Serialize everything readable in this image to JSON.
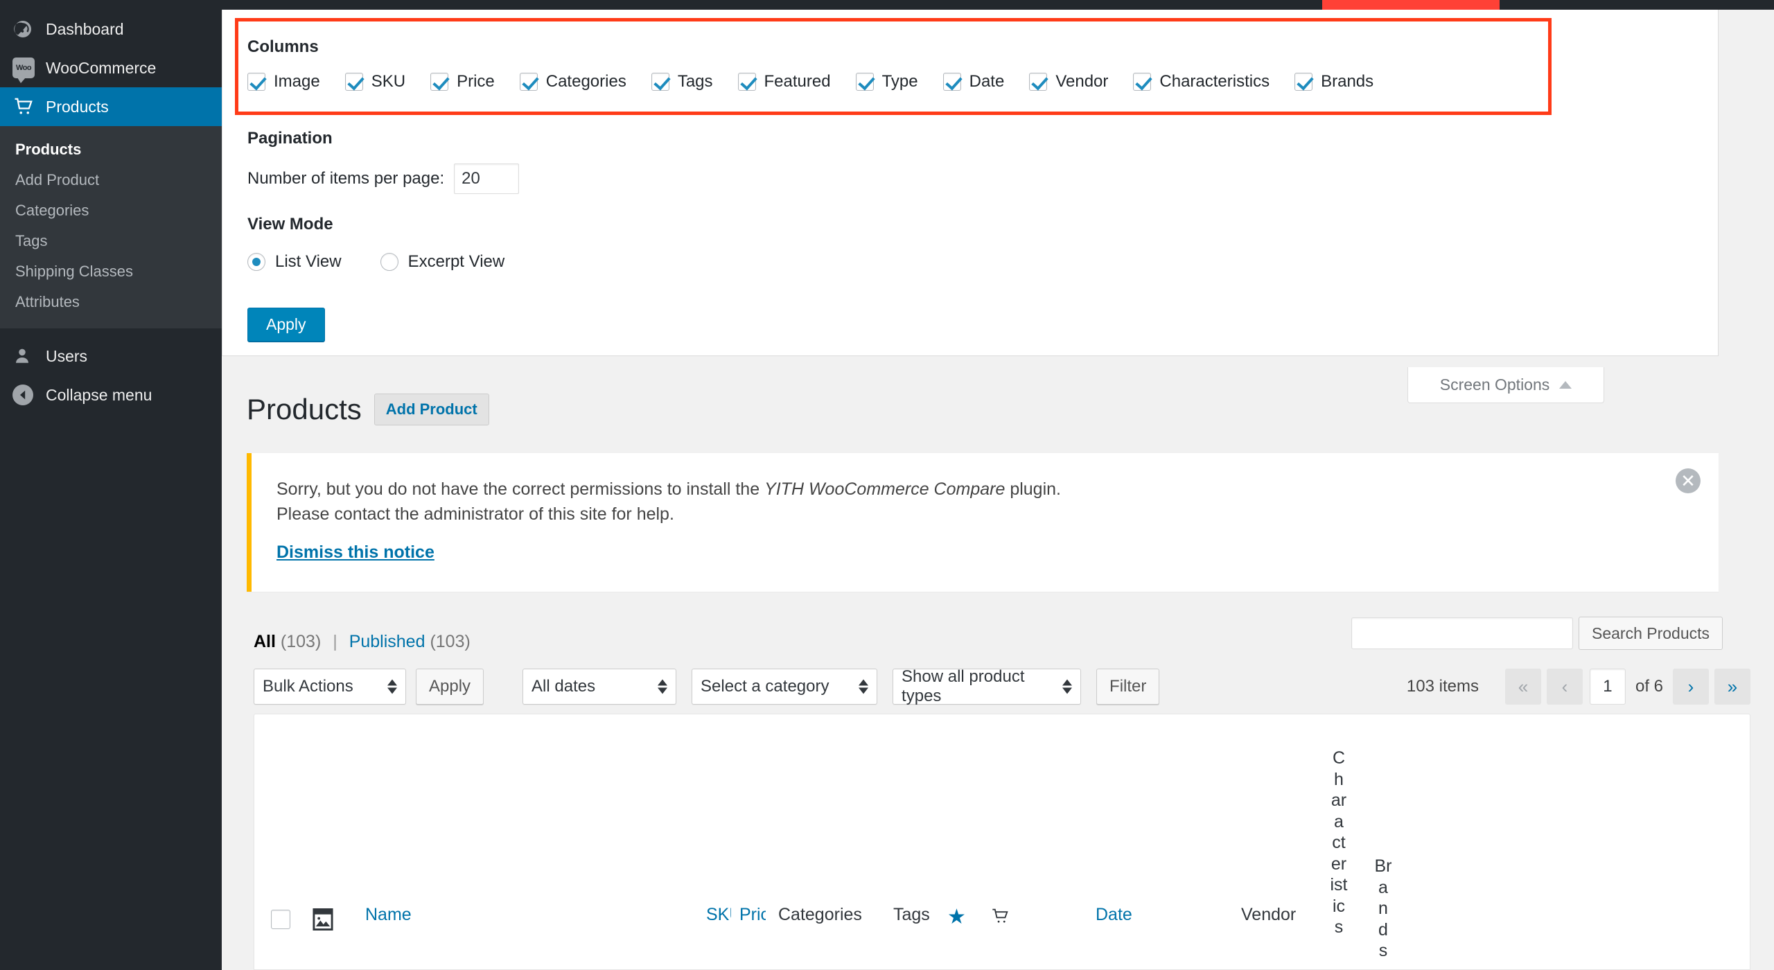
{
  "sidebar": {
    "items": [
      {
        "label": "Dashboard",
        "icon": "dashboard-icon",
        "current": false
      },
      {
        "label": "WooCommerce",
        "icon": "woo-icon",
        "current": false
      },
      {
        "label": "Products",
        "icon": "cart-icon",
        "current": true
      }
    ],
    "submenu": [
      {
        "label": "Products",
        "active": true
      },
      {
        "label": "Add Product",
        "active": false
      },
      {
        "label": "Categories",
        "active": false
      },
      {
        "label": "Tags",
        "active": false
      },
      {
        "label": "Shipping Classes",
        "active": false
      },
      {
        "label": "Attributes",
        "active": false
      }
    ],
    "bottom": [
      {
        "label": "Users",
        "icon": "user-icon"
      },
      {
        "label": "Collapse menu",
        "icon": "collapse-arrow-icon"
      }
    ]
  },
  "screen_options": {
    "columns_title": "Columns",
    "columns": [
      {
        "label": "Image",
        "checked": true
      },
      {
        "label": "SKU",
        "checked": true
      },
      {
        "label": "Price",
        "checked": true
      },
      {
        "label": "Categories",
        "checked": true
      },
      {
        "label": "Tags",
        "checked": true
      },
      {
        "label": "Featured",
        "checked": true
      },
      {
        "label": "Type",
        "checked": true
      },
      {
        "label": "Date",
        "checked": true
      },
      {
        "label": "Vendor",
        "checked": true
      },
      {
        "label": "Characteristics",
        "checked": true
      },
      {
        "label": "Brands",
        "checked": true
      }
    ],
    "pagination_title": "Pagination",
    "items_per_page_label": "Number of items per page:",
    "items_per_page_value": "20",
    "view_mode_title": "View Mode",
    "view_modes": [
      {
        "label": "List View",
        "selected": true
      },
      {
        "label": "Excerpt View",
        "selected": false
      }
    ],
    "apply_label": "Apply",
    "tab_label": "Screen Options",
    "highlight_color": "#ff3b18"
  },
  "page": {
    "title": "Products",
    "add_new_label": "Add Product"
  },
  "notice": {
    "text_before": "Sorry, but you do not have the correct permissions to install the ",
    "plugin_name": "YITH WooCommerce Compare",
    "text_after": " plugin.",
    "line2": "Please contact the administrator of this site for help.",
    "dismiss_link": "Dismiss this notice",
    "close_icon": "close-icon",
    "accent_color": "#ffb900"
  },
  "filters": {
    "status_links": [
      {
        "label": "All",
        "count": "(103)",
        "current": true
      },
      {
        "label": "Published",
        "count": "(103)",
        "current": false
      }
    ],
    "divider": "|",
    "bulk_actions": "Bulk Actions",
    "apply_label": "Apply",
    "dates": "All dates",
    "category": "Select a category",
    "product_types": "Show all product types",
    "filter_label": "Filter",
    "search_value": "",
    "search_placeholder": "",
    "search_button": "Search Products"
  },
  "pagination": {
    "items_label": "103 items",
    "first": "«",
    "prev": "‹",
    "current_page": "1",
    "of_label": "of 6",
    "next": "›",
    "last": "»"
  },
  "table": {
    "columns": [
      {
        "name": "checkbox",
        "label": ""
      },
      {
        "name": "image",
        "label": ""
      },
      {
        "name": "name",
        "label": "Name",
        "link": true
      },
      {
        "name": "sku",
        "label": "SKU",
        "link": true
      },
      {
        "name": "price",
        "label": "Price",
        "link": true
      },
      {
        "name": "categories",
        "label": "Categories",
        "link": false
      },
      {
        "name": "tags",
        "label": "Tags",
        "link": false
      },
      {
        "name": "featured",
        "label": "★",
        "link": true
      },
      {
        "name": "in-stock",
        "label": "",
        "link": false
      },
      {
        "name": "date",
        "label": "Date",
        "link": true
      },
      {
        "name": "vendor",
        "label": "Vendor",
        "link": false
      },
      {
        "name": "characteristics",
        "label": "Characteristics",
        "link": false
      },
      {
        "name": "brands",
        "label": "Brands",
        "link": false
      }
    ]
  }
}
